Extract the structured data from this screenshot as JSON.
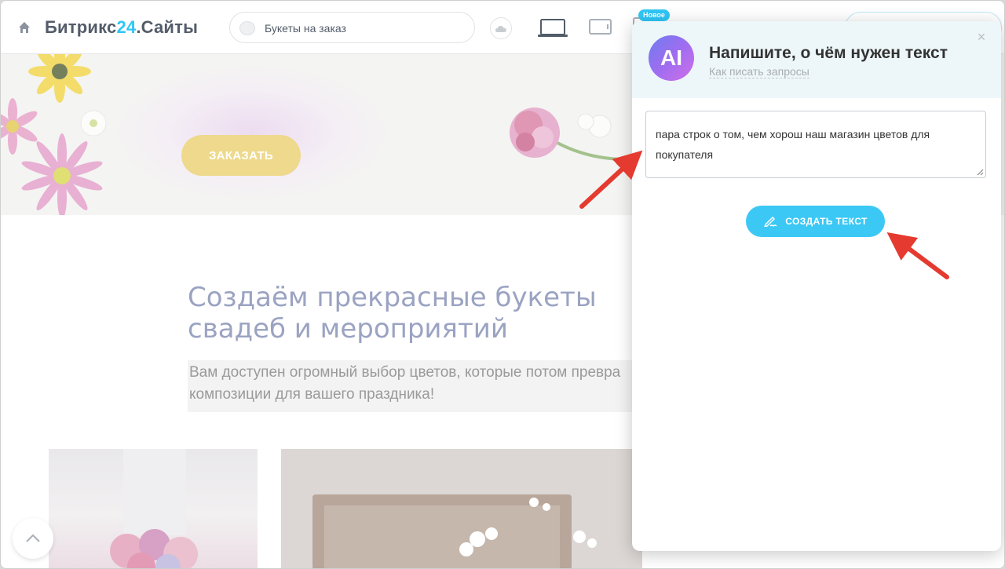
{
  "topbar": {
    "brand_part1": "Битрикс",
    "brand_part2": "24",
    "brand_part3": ".Сайты",
    "page_name": "Букеты на заказ",
    "new_badge": "Новое",
    "icons": [
      "home-icon",
      "cloud-icon",
      "laptop-icon",
      "tablet-icon",
      "mobile-icon"
    ]
  },
  "hero": {
    "order_button": "ЗАКАЗАТЬ"
  },
  "content": {
    "heading_line1": "Создаём прекрасные букеты",
    "heading_line2": "свадеб и мероприятий",
    "lead_line1": "Вам доступен огромный выбор цветов, которые потом превра",
    "lead_line2": "композиции для вашего праздника!"
  },
  "ai_popup": {
    "logo_text": "AI",
    "title": "Напишите, о чём нужен текст",
    "help_link": "Как писать запросы",
    "prompt_value": "пара строк о том, чем хорош наш магазин цветов для покупателя",
    "generate_button": "СОЗДАТЬ ТЕКСТ"
  },
  "colors": {
    "accent": "#2fc6f6",
    "button": "#3bc8f5",
    "order_button": "#eed98c",
    "heading": "#9ba3c2",
    "annotation_arrow": "#e53a2f"
  }
}
